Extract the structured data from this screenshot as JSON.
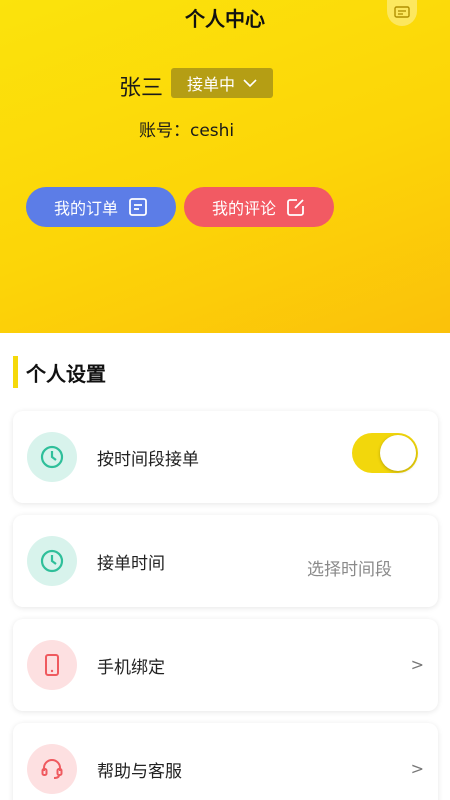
{
  "header": {
    "title": "个人中心",
    "message_icon": "message-icon"
  },
  "user": {
    "name": "张三",
    "status_label": "接单中",
    "account_label": "账号：ceshi"
  },
  "actions": {
    "orders_label": "我的订单",
    "reviews_label": "我的评论"
  },
  "section": {
    "title": "个人设置"
  },
  "settings": [
    {
      "icon": "clock-icon",
      "label": "按时间段接单",
      "control": "toggle",
      "toggle_on": true
    },
    {
      "icon": "clock-icon",
      "label": "接单时间",
      "value": "选择时间段"
    },
    {
      "icon": "phone-icon",
      "label": "手机绑定",
      "arrow": ">"
    },
    {
      "icon": "headset-icon",
      "label": "帮助与客服",
      "arrow": ">"
    }
  ],
  "colors": {
    "brand_yellow": "#fcd508",
    "orders_blue": "#5c7de7",
    "reviews_red": "#f25a63",
    "icon_green": "#2fbf9a",
    "icon_red": "#ef5a5f"
  }
}
